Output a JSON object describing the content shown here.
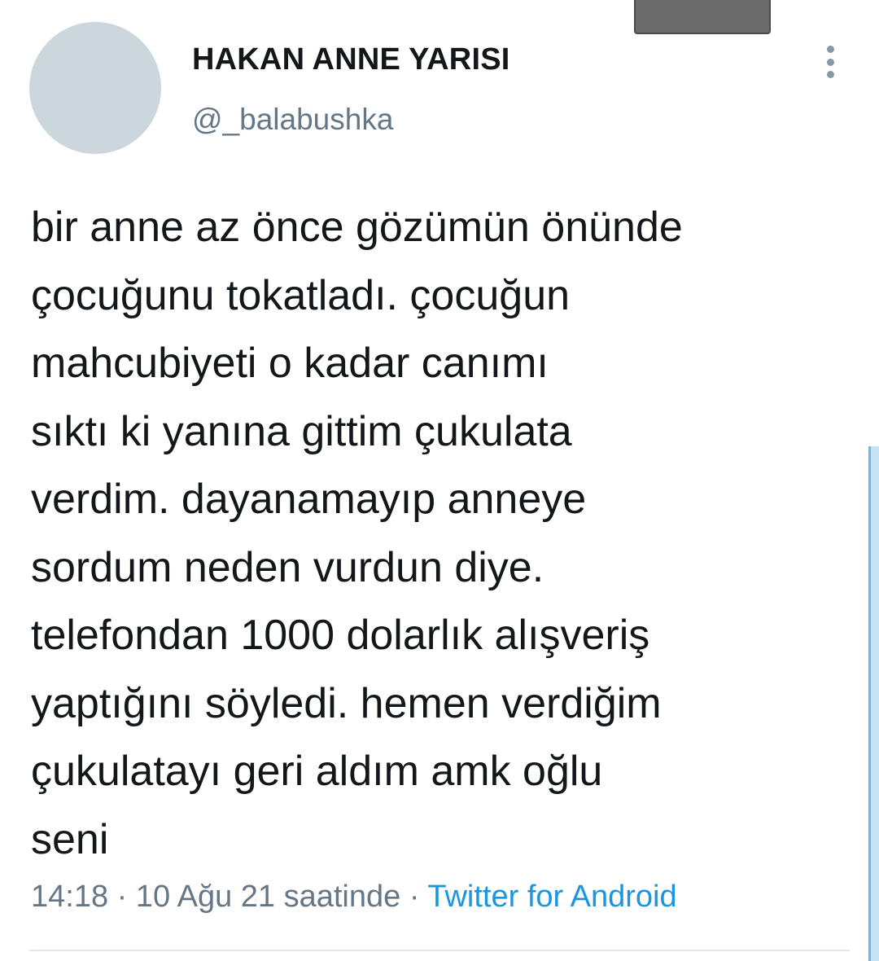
{
  "user": {
    "display_name": "HAKAN ANNE YARISI",
    "handle": "@_balabushka"
  },
  "tweet": {
    "text": "bir anne az önce gözümün önünde\nçocuğunu tokatladı. çocuğun\nmahcubiyeti o kadar canımı\nsıktı ki yanına gittim çukulata\nverdim. dayanamayıp anneye\nsordum neden vurdun diye.\ntelefondan 1000 dolarlık alışveriş\nyaptığını söyledi. hemen verdiğim\nçukulatayı geri aldım amk oğlu\nseni",
    "time": "14:18",
    "date": "10 Ağu 21 saatinde",
    "separator": "·",
    "source": "Twitter for Android"
  },
  "icons": {
    "more": "more-vertical-icon"
  },
  "colors": {
    "text_primary": "#14171a",
    "text_secondary": "#657786",
    "link": "#1b95e0",
    "avatar_placeholder": "#ccd6dd",
    "divider": "#e1e8ed"
  }
}
